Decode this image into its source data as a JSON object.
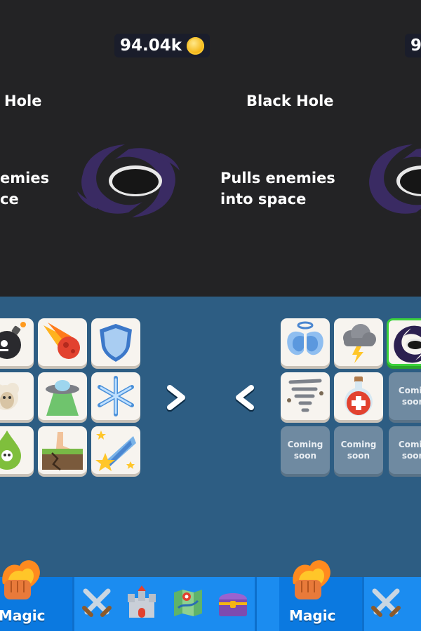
{
  "currency": {
    "amount": "94.04k",
    "amount_right_partial": "9"
  },
  "panels": {
    "left": {
      "title_partial": "Hole",
      "desc_partial": "emies\nce"
    },
    "center": {
      "title": "Black Hole",
      "desc": "Pulls enemies\ninto space"
    }
  },
  "coming_soon": "Coming\nsoon",
  "coming_soon_partial": "Comin\nsoon",
  "nav": {
    "magic_label": "Magic"
  },
  "icons": {
    "left_grid": [
      "bomb-icon",
      "meteor-icon",
      "shield-icon",
      "sheep-icon",
      "ufo-icon",
      "snowflake-icon",
      "poison-icon",
      "earthquake-icon",
      "shooting-star-icon"
    ],
    "right_grid": [
      "angel-wings-icon",
      "storm-cloud-icon",
      "black-hole-icon",
      "tornado-icon",
      "health-potion-icon"
    ],
    "nav": [
      "flaming-fist-icon",
      "crossed-swords-icon",
      "castle-icon",
      "map-icon",
      "treasure-chest-icon"
    ]
  },
  "colors": {
    "selected": "#3bd23b",
    "nav_blue": "#1b8cf0",
    "panel_dark": "#232325",
    "board_blue": "#2d5d83"
  }
}
